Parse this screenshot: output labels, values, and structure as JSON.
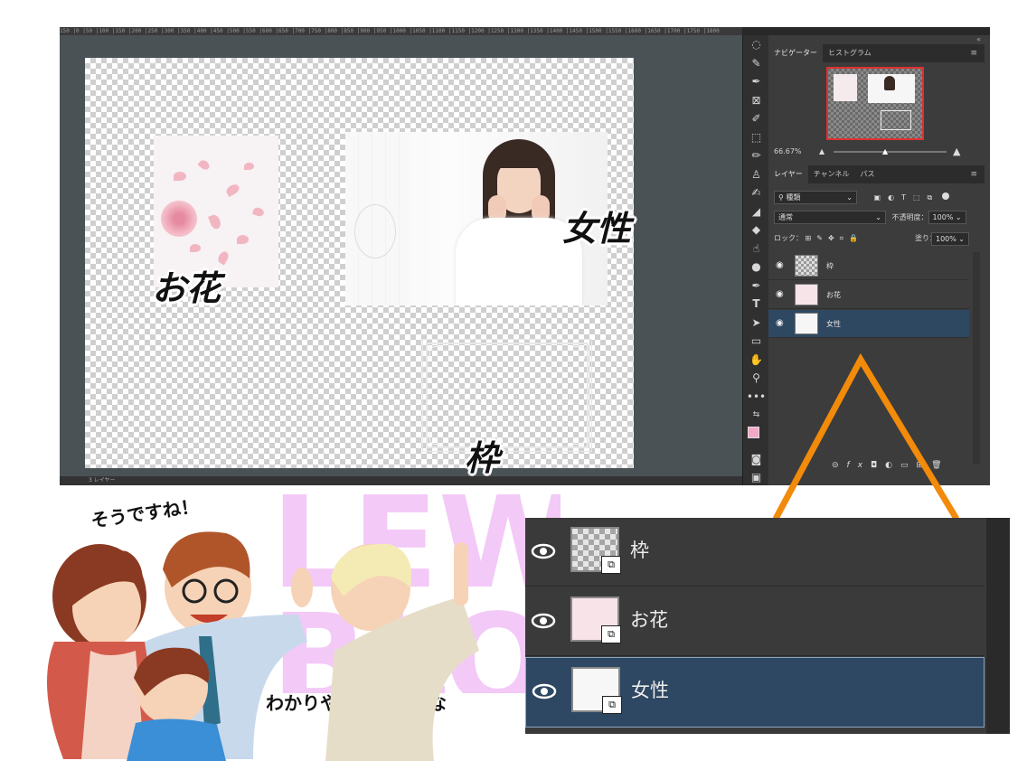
{
  "photoshop": {
    "ruler_text": "150 |0 |50 |100 |150 |200 |250 |300 |350 |400 |450 |500 |550 |600 |650 |700 |750 |800 |850 |900 |950 |1000 |1050 |1100 |1150 |1200 |1250 |1300 |1350 |1400 |1450 |1500 |1550 |1600 |1650 |1700 |1750 |1800",
    "status_text": "3 レイヤー",
    "canvas_labels": {
      "flowers": "お花",
      "woman": "女性",
      "frame": "枠"
    },
    "navigator": {
      "tabs": [
        "ナビゲーター",
        "ヒストグラム"
      ],
      "zoom": "66.67%"
    },
    "layers_panel": {
      "tabs": [
        "レイヤー",
        "チャンネル",
        "パス"
      ],
      "filter_kind": "種類",
      "blend_mode": "通常",
      "opacity_label": "不透明度：",
      "opacity_value": "100%",
      "lock_label": "ロック：",
      "fill_label": "塗り：",
      "fill_value": "100%",
      "layers": [
        {
          "name": "枠",
          "selected": false
        },
        {
          "name": "お花",
          "selected": false
        },
        {
          "name": "女性",
          "selected": true
        }
      ]
    }
  },
  "illustration": {
    "speech_agree": "そうですね！",
    "speech_clear": "わかりやすくなったな",
    "bg_letters": "LEW BLO"
  },
  "zoomed_layers": [
    {
      "name": "枠",
      "selected": false
    },
    {
      "name": "お花",
      "selected": false
    },
    {
      "name": "女性",
      "selected": true
    }
  ],
  "colors": {
    "highlight_arrow": "#f28a0a",
    "selected_layer": "#2f4862",
    "foreground_swatch": "#f3a8c8"
  }
}
